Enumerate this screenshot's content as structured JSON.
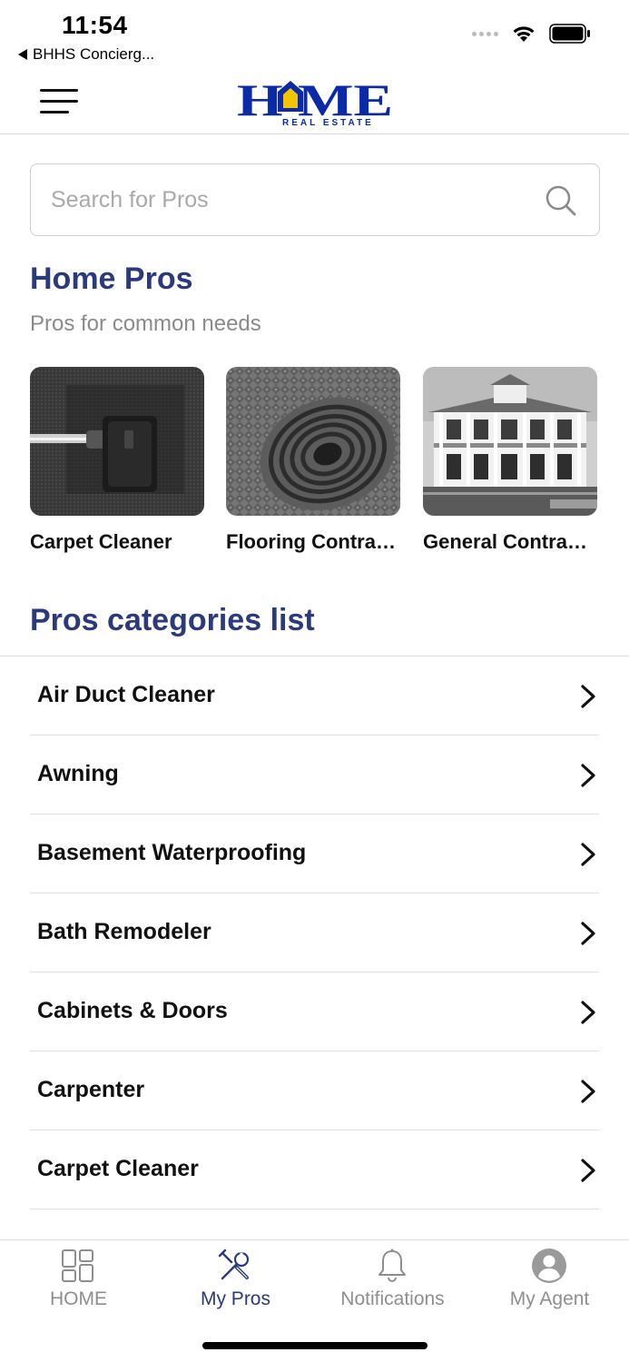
{
  "status_bar": {
    "time": "11:54",
    "back_app": "BHHS Concierg..."
  },
  "header": {
    "logo_word": "HOME",
    "logo_tagline": "REAL ESTATE",
    "menu_icon": "hamburger-menu-icon"
  },
  "search": {
    "placeholder": "Search for Pros",
    "icon": "search-icon"
  },
  "home_pros": {
    "title": "Home Pros",
    "subtitle": "Pros for common needs",
    "cards": [
      {
        "label": "Carpet Cleaner"
      },
      {
        "label": "Flooring Contrac..."
      },
      {
        "label": "General Contract..."
      }
    ]
  },
  "categories": {
    "title": "Pros categories list",
    "items": [
      {
        "label": "Air Duct Cleaner"
      },
      {
        "label": "Awning"
      },
      {
        "label": "Basement Waterproofing"
      },
      {
        "label": "Bath Remodeler"
      },
      {
        "label": "Cabinets & Doors"
      },
      {
        "label": "Carpenter"
      },
      {
        "label": "Carpet Cleaner"
      }
    ]
  },
  "tab_bar": {
    "tabs": [
      {
        "label": "HOME",
        "icon": "grid-icon"
      },
      {
        "label": "My Pros",
        "icon": "tools-icon",
        "active": true
      },
      {
        "label": "Notifications",
        "icon": "bell-icon"
      },
      {
        "label": "My Agent",
        "icon": "user-icon"
      }
    ]
  },
  "colors": {
    "brand_blue": "#2b3a7a",
    "logo_blue": "#0a2aa8",
    "logo_yellow": "#f5c400",
    "inactive_gray": "#8e8e8e"
  }
}
